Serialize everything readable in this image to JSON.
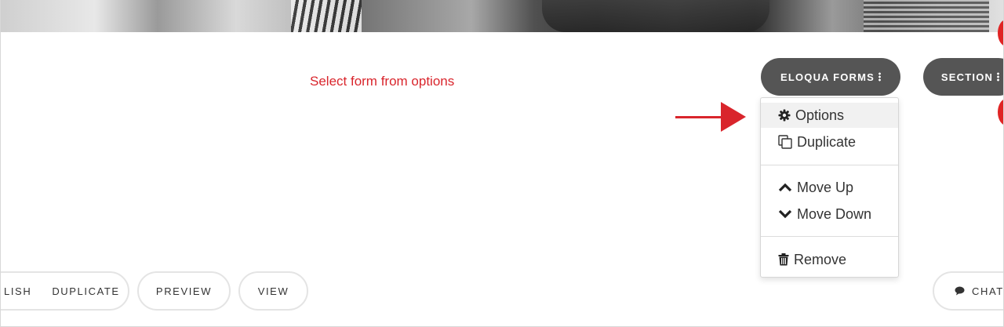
{
  "hint_text": "Select form from options",
  "toolbar": {
    "eloqua_forms_label": "ELOQUA FORMS",
    "section_label": "SECTION"
  },
  "menu": {
    "options": "Options",
    "duplicate": "Duplicate",
    "move_up": "Move Up",
    "move_down": "Move Down",
    "remove": "Remove"
  },
  "bottom_bar": {
    "publish_label": "LISH",
    "duplicate_label": "DUPLICATE",
    "preview_label": "PREVIEW",
    "view_label": "VIEW",
    "chat_label": "CHAT"
  },
  "colors": {
    "accent_red": "#d9252c",
    "pill_dark": "#555555"
  },
  "icons": [
    "gear-icon",
    "copy-icon",
    "chevron-up-icon",
    "chevron-down-icon",
    "trash-icon",
    "chat-bubble-icon",
    "kebab-icon",
    "arrow-right-icon"
  ]
}
